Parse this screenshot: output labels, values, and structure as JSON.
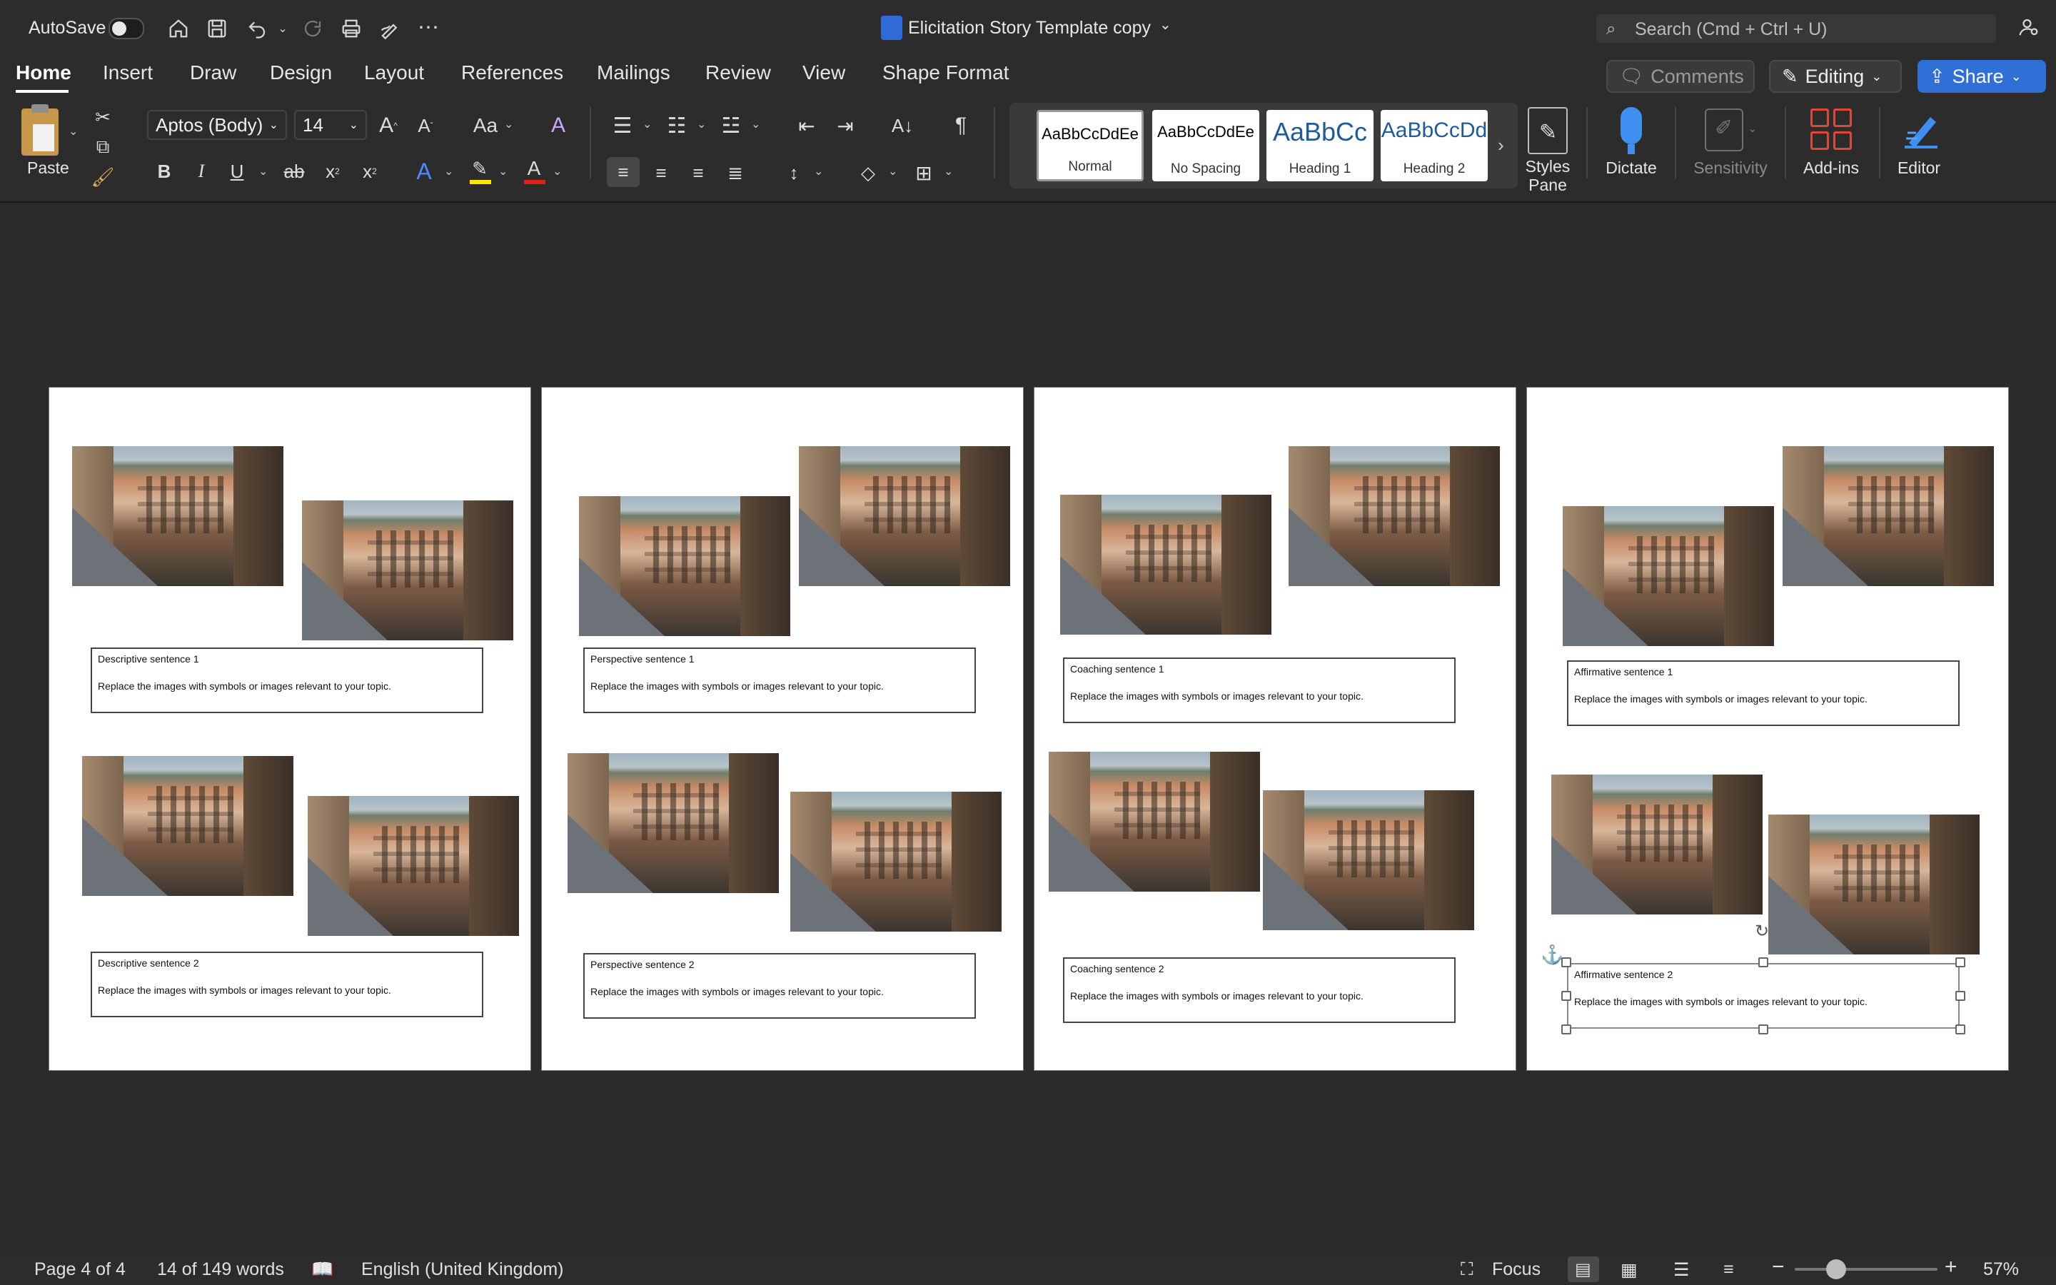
{
  "titlebar": {
    "autosave_label": "AutoSave",
    "doc_title": "Elicitation Story Template copy",
    "search_placeholder": "Search (Cmd + Ctrl + U)"
  },
  "tabs": [
    "Home",
    "Insert",
    "Draw",
    "Design",
    "Layout",
    "References",
    "Mailings",
    "Review",
    "View",
    "Shape Format"
  ],
  "actions": {
    "comments": "Comments",
    "editing": "Editing",
    "share": "Share"
  },
  "ribbon": {
    "paste": "Paste",
    "font_name": "Aptos (Body)",
    "font_size": "14",
    "change_case": "Aa",
    "styles": [
      {
        "preview": "AaBbCcDdEe",
        "name": "Normal"
      },
      {
        "preview": "AaBbCcDdEe",
        "name": "No Spacing"
      },
      {
        "preview": "AaBbCc",
        "name": "Heading 1"
      },
      {
        "preview": "AaBbCcDd",
        "name": "Heading 2"
      }
    ],
    "styles_pane": [
      "Styles",
      "Pane"
    ],
    "dictate": "Dictate",
    "sensitivity": "Sensitivity",
    "addins": "Add-ins",
    "editor": "Editor"
  },
  "pages": [
    {
      "box1_title": "Descriptive sentence 1",
      "box2_title": "Descriptive sentence 2"
    },
    {
      "box1_title": "Perspective sentence 1",
      "box2_title": "Perspective sentence 2"
    },
    {
      "box1_title": "Coaching sentence 1",
      "box2_title": "Coaching sentence 2"
    },
    {
      "box1_title": "Affirmative sentence 1",
      "box2_title": "Affirmative sentence 2"
    }
  ],
  "box_body": "Replace the images with symbols or images relevant to your topic.",
  "status": {
    "page": "Page 4 of 4",
    "words": "14 of 149 words",
    "language": "English (United Kingdom)",
    "focus": "Focus",
    "zoom": "57%"
  },
  "colors": {
    "accent": "#3b82f6",
    "ribbon_bg": "#2c2c2c",
    "canvas_bg": "#2b2b2b"
  }
}
